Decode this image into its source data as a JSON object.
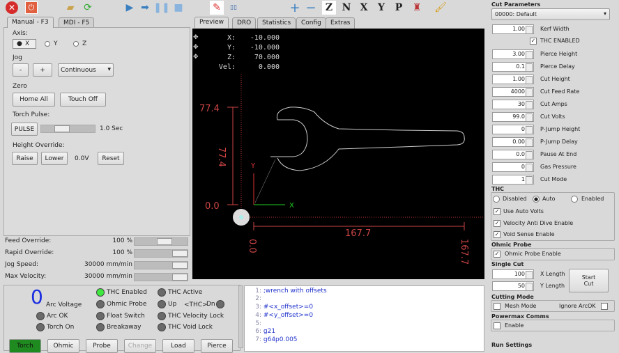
{
  "toolbar": {
    "icons": [
      "estop-icon",
      "power-icon",
      "open-file-icon",
      "reload-icon",
      "run-icon",
      "step-icon",
      "pause-icon",
      "stop-icon",
      "edit-icon",
      "rfl-icon",
      "zoom-in-icon",
      "zoom-out-icon",
      "view-z-icon",
      "view-z2-icon",
      "view-x-icon",
      "view-y-icon",
      "view-p-icon",
      "clear-plot-icon",
      "brush-icon"
    ],
    "letters": {
      "z": "Z",
      "z2": "N",
      "x": "X",
      "y": "Y",
      "p": "P"
    }
  },
  "left_tabs": [
    "Manual - F3",
    "MDI - F5"
  ],
  "right_tabs": [
    "Preview",
    "DRO",
    "Statistics",
    "Config",
    "Extras"
  ],
  "manual": {
    "axis_label": "Axis:",
    "axes": [
      "X",
      "Y",
      "Z"
    ],
    "selected_axis": "X",
    "jog_label": "Jog",
    "jog_minus": "-",
    "jog_plus": "+",
    "jog_mode": "Continuous",
    "zero_label": "Zero",
    "home_all": "Home All",
    "touch_off": "Touch Off",
    "torch_pulse_label": "Torch Pulse:",
    "pulse": "PULSE",
    "pulse_time": "1.0 Sec",
    "pulse_slider": 0.35,
    "height_override_label": "Height Override:",
    "raise": "Raise",
    "lower": "Lower",
    "override_value": "0.0V",
    "reset": "Reset"
  },
  "overrides": [
    {
      "label": "Feed Override:",
      "value": "100 %",
      "level": 0.6
    },
    {
      "label": "Rapid Override:",
      "value": "100 %",
      "level": 1.0
    },
    {
      "label": "Jog Speed:",
      "value": "30000 mm/min",
      "level": 1.0
    },
    {
      "label": "Max Velocity:",
      "value": "30000 mm/min",
      "level": 1.0
    }
  ],
  "dro": [
    {
      "axis": "X:",
      "value": "-10.000"
    },
    {
      "axis": "Y:",
      "value": "-10.000"
    },
    {
      "axis": "Z:",
      "value": "70.000"
    },
    {
      "axis": "Vel:",
      "value": "0.000"
    }
  ],
  "preview": {
    "y_max": "77.4",
    "y_min": "0.0",
    "y_size": "77.4",
    "x_size": "167.7",
    "x_min": "0.0",
    "x_max": "167.7",
    "x_axis": "X",
    "y_axis": "Y"
  },
  "status": {
    "arc_voltage": "0",
    "arc_voltage_label": "Arc Voltage",
    "leds": [
      {
        "label": "THC Enabled",
        "on": true
      },
      {
        "label": "THC Active",
        "on": false
      },
      {
        "label": "Ohmic Probe",
        "on": false
      },
      {
        "label": "Up",
        "on": false
      },
      {
        "label": "Dn",
        "on": false
      },
      {
        "label": "Float Switch",
        "on": false
      },
      {
        "label": "THC Velocity Lock",
        "on": false
      },
      {
        "label": "Breakaway",
        "on": false
      },
      {
        "label": "THC Void Lock",
        "on": false
      },
      {
        "label": "Arc OK",
        "on": false
      },
      {
        "label": "Torch On",
        "on": false
      }
    ],
    "thc_label": "<THC>"
  },
  "bottom_buttons": [
    "Torch",
    "Ohmic",
    "Probe",
    "Change",
    "Load",
    "Pierce"
  ],
  "code": [
    {
      "n": "1:",
      "t": ";wrench with offsets"
    },
    {
      "n": "2:",
      "t": ""
    },
    {
      "n": "3:",
      "t": "#<x_offset>=0"
    },
    {
      "n": "4:",
      "t": "#<y_offset>=0"
    },
    {
      "n": "5:",
      "t": ""
    },
    {
      "n": "6:",
      "t": "g21"
    },
    {
      "n": "7:",
      "t": "g64p0.005"
    }
  ],
  "cut_params": {
    "title": "Cut Parameters",
    "material": "00000: Default",
    "fields": [
      {
        "value": "1.00",
        "label": "Kerf Width"
      },
      {
        "value": "3.00",
        "label": "Pierce Height"
      },
      {
        "value": "0.1",
        "label": "Pierce Delay"
      },
      {
        "value": "1.00",
        "label": "Cut Height"
      },
      {
        "value": "4000",
        "label": "Cut Feed Rate"
      },
      {
        "value": "30",
        "label": "Cut Amps"
      },
      {
        "value": "99.0",
        "label": "Cut Volts"
      },
      {
        "value": "0",
        "label": "P-Jump Height"
      },
      {
        "value": "0.00",
        "label": "P-Jump Delay"
      },
      {
        "value": "0.0",
        "label": "Pause At End"
      },
      {
        "value": "0",
        "label": "Gas Pressure"
      },
      {
        "value": "1",
        "label": "Cut Mode"
      }
    ],
    "thc_enabled_label": "THC ENABLED"
  },
  "thc": {
    "title": "THC",
    "modes": [
      "Disabled",
      "Auto",
      "Enabled"
    ],
    "selected": "Auto",
    "use_auto_volts": "Use Auto Volts",
    "velocity_anti_dive": "Velocity Anti Dive Enable",
    "void_sense": "Void Sense Enable"
  },
  "ohmic": {
    "title": "Ohmic Probe",
    "enable": "Ohmic Probe Enable"
  },
  "single_cut": {
    "title": "Single Cut",
    "x_value": "100",
    "x_label": "X Length",
    "y_value": "50",
    "y_label": "Y Length",
    "start": "Start Cut"
  },
  "cutting_mode": {
    "title": "Cutting Mode",
    "mesh": "Mesh Mode",
    "ignore_arc_ok": "Ignore ArcOK"
  },
  "powermax": {
    "title": "Powermax Comms",
    "enable": "Enable"
  },
  "run_settings": {
    "title": "Run Settings"
  }
}
